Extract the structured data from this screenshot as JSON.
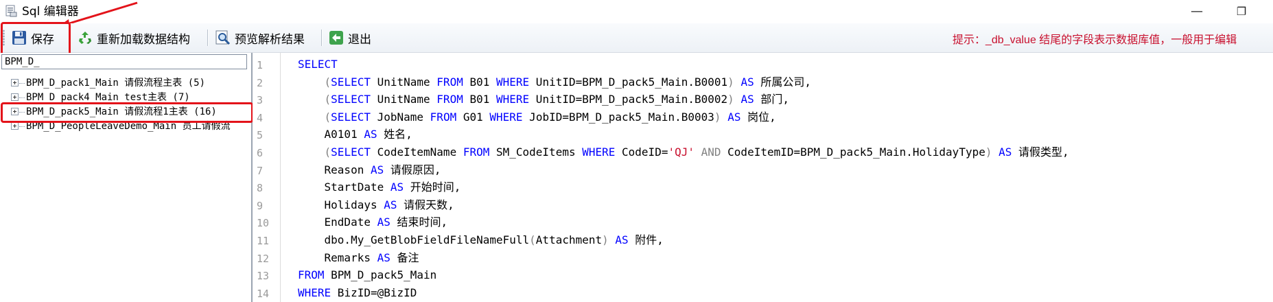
{
  "window": {
    "title": "Sql 编辑器",
    "minimize_glyph": "—",
    "maximize_glyph": "❐"
  },
  "toolbar": {
    "save_label": "保存",
    "reload_label": "重新加载数据结构",
    "preview_label": "预览解析结果",
    "exit_label": "退出",
    "hint": "提示：_db_value 结尾的字段表示数据库值，一般用于编辑"
  },
  "tree": {
    "search_value": "BPM_D_",
    "nodes": [
      {
        "label": "BPM_D_pack1_Main 请假流程主表 (5)"
      },
      {
        "label": "BPM_D_pack4_Main test主表 (7)"
      },
      {
        "label": "BPM_D_pack5_Main 请假流程1主表 (16)"
      },
      {
        "label": "BPM_D_PeopleLeaveDemo_Main 员工请假流"
      }
    ]
  },
  "editor": {
    "line_numbers": [
      "1",
      "2",
      "3",
      "4",
      "5",
      "6",
      "7",
      "8",
      "9",
      "10",
      "11",
      "12",
      "13",
      "14"
    ],
    "lines": [
      [
        {
          "t": "kw",
          "v": "SELECT"
        }
      ],
      [
        {
          "t": "p",
          "v": "    "
        },
        {
          "t": "op",
          "v": "("
        },
        {
          "t": "kw",
          "v": "SELECT"
        },
        {
          "t": "p",
          "v": " UnitName "
        },
        {
          "t": "kw",
          "v": "FROM"
        },
        {
          "t": "p",
          "v": " B01 "
        },
        {
          "t": "kw",
          "v": "WHERE"
        },
        {
          "t": "p",
          "v": " UnitID=BPM_D_pack5_Main.B0001"
        },
        {
          "t": "op",
          "v": ")"
        },
        {
          "t": "p",
          "v": " "
        },
        {
          "t": "kw",
          "v": "AS"
        },
        {
          "t": "p",
          "v": " 所属公司,"
        }
      ],
      [
        {
          "t": "p",
          "v": "    "
        },
        {
          "t": "op",
          "v": "("
        },
        {
          "t": "kw",
          "v": "SELECT"
        },
        {
          "t": "p",
          "v": " UnitName "
        },
        {
          "t": "kw",
          "v": "FROM"
        },
        {
          "t": "p",
          "v": " B01 "
        },
        {
          "t": "kw",
          "v": "WHERE"
        },
        {
          "t": "p",
          "v": " UnitID=BPM_D_pack5_Main.B0002"
        },
        {
          "t": "op",
          "v": ")"
        },
        {
          "t": "p",
          "v": " "
        },
        {
          "t": "kw",
          "v": "AS"
        },
        {
          "t": "p",
          "v": " 部门,"
        }
      ],
      [
        {
          "t": "p",
          "v": "    "
        },
        {
          "t": "op",
          "v": "("
        },
        {
          "t": "kw",
          "v": "SELECT"
        },
        {
          "t": "p",
          "v": " JobName "
        },
        {
          "t": "kw",
          "v": "FROM"
        },
        {
          "t": "p",
          "v": " G01 "
        },
        {
          "t": "kw",
          "v": "WHERE"
        },
        {
          "t": "p",
          "v": " JobID=BPM_D_pack5_Main.B0003"
        },
        {
          "t": "op",
          "v": ")"
        },
        {
          "t": "p",
          "v": " "
        },
        {
          "t": "kw",
          "v": "AS"
        },
        {
          "t": "p",
          "v": " 岗位,"
        }
      ],
      [
        {
          "t": "p",
          "v": "    A0101 "
        },
        {
          "t": "kw",
          "v": "AS"
        },
        {
          "t": "p",
          "v": " 姓名,"
        }
      ],
      [
        {
          "t": "p",
          "v": "    "
        },
        {
          "t": "op",
          "v": "("
        },
        {
          "t": "kw",
          "v": "SELECT"
        },
        {
          "t": "p",
          "v": " CodeItemName "
        },
        {
          "t": "kw",
          "v": "FROM"
        },
        {
          "t": "p",
          "v": " SM_CodeItems "
        },
        {
          "t": "kw",
          "v": "WHERE"
        },
        {
          "t": "p",
          "v": " CodeID="
        },
        {
          "t": "str",
          "v": "'QJ'"
        },
        {
          "t": "p",
          "v": " "
        },
        {
          "t": "op",
          "v": "AND"
        },
        {
          "t": "p",
          "v": " CodeItemID=BPM_D_pack5_Main.HolidayType"
        },
        {
          "t": "op",
          "v": ")"
        },
        {
          "t": "p",
          "v": " "
        },
        {
          "t": "kw",
          "v": "AS"
        },
        {
          "t": "p",
          "v": " 请假类型,"
        }
      ],
      [
        {
          "t": "p",
          "v": "    Reason "
        },
        {
          "t": "kw",
          "v": "AS"
        },
        {
          "t": "p",
          "v": " 请假原因,"
        }
      ],
      [
        {
          "t": "p",
          "v": "    StartDate "
        },
        {
          "t": "kw",
          "v": "AS"
        },
        {
          "t": "p",
          "v": " 开始时间,"
        }
      ],
      [
        {
          "t": "p",
          "v": "    Holidays "
        },
        {
          "t": "kw",
          "v": "AS"
        },
        {
          "t": "p",
          "v": " 请假天数,"
        }
      ],
      [
        {
          "t": "p",
          "v": "    EndDate "
        },
        {
          "t": "kw",
          "v": "AS"
        },
        {
          "t": "p",
          "v": " 结束时间,"
        }
      ],
      [
        {
          "t": "p",
          "v": "    dbo.My_GetBlobFieldFileNameFull"
        },
        {
          "t": "op",
          "v": "("
        },
        {
          "t": "p",
          "v": "Attachment"
        },
        {
          "t": "op",
          "v": ")"
        },
        {
          "t": "p",
          "v": " "
        },
        {
          "t": "kw",
          "v": "AS"
        },
        {
          "t": "p",
          "v": " 附件,"
        }
      ],
      [
        {
          "t": "p",
          "v": "    Remarks "
        },
        {
          "t": "kw",
          "v": "AS"
        },
        {
          "t": "p",
          "v": " 备注"
        }
      ],
      [
        {
          "t": "kw",
          "v": "FROM"
        },
        {
          "t": "p",
          "v": " BPM_D_pack5_Main"
        }
      ],
      [
        {
          "t": "kw",
          "v": "WHERE"
        },
        {
          "t": "p",
          "v": " BizID=@BizID"
        }
      ]
    ]
  },
  "colors": {
    "keyword": "#0000ff",
    "string": "#c8102e",
    "operator": "#808080",
    "hint": "#c8102e",
    "annotation": "#e3131a"
  },
  "icons": {
    "app": "sql-editor-app-icon",
    "save": "floppy-disk-icon",
    "reload": "recycle-refresh-icon",
    "preview": "magnifier-preview-icon",
    "exit": "green-back-arrow-icon"
  }
}
